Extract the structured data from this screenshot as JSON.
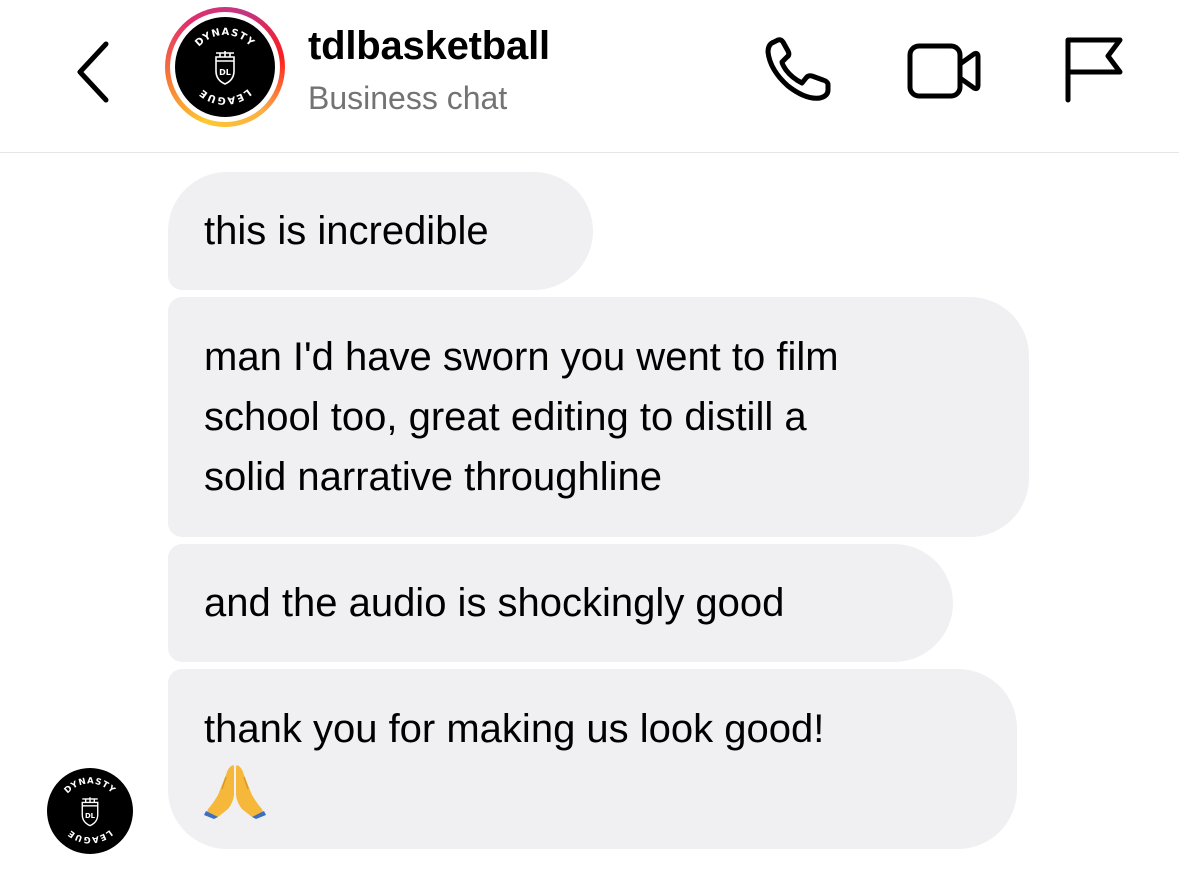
{
  "header": {
    "username": "tdlbasketball",
    "subtitle": "Business chat",
    "back_icon": "chevron-left-icon",
    "phone_icon": "phone-icon",
    "video_icon": "video-camera-icon",
    "flag_icon": "flag-icon"
  },
  "logo": {
    "top_text": "DYNASTY",
    "bottom_text": "LEAGUE",
    "badge_text": "DL"
  },
  "colors": {
    "bubble": "#f0f0f3",
    "subtitle": "#737373",
    "divider": "#e6e6e6"
  },
  "messages": [
    {
      "lines": [
        "this is incredible"
      ]
    },
    {
      "lines": [
        "man I'd have sworn you went to film",
        "school too, great editing to distill a",
        "solid narrative throughline"
      ]
    },
    {
      "lines": [
        "and the audio is shockingly good"
      ]
    },
    {
      "lines": [
        "thank you for making us look good!"
      ],
      "emoji": "folded-hands-emoji"
    }
  ]
}
